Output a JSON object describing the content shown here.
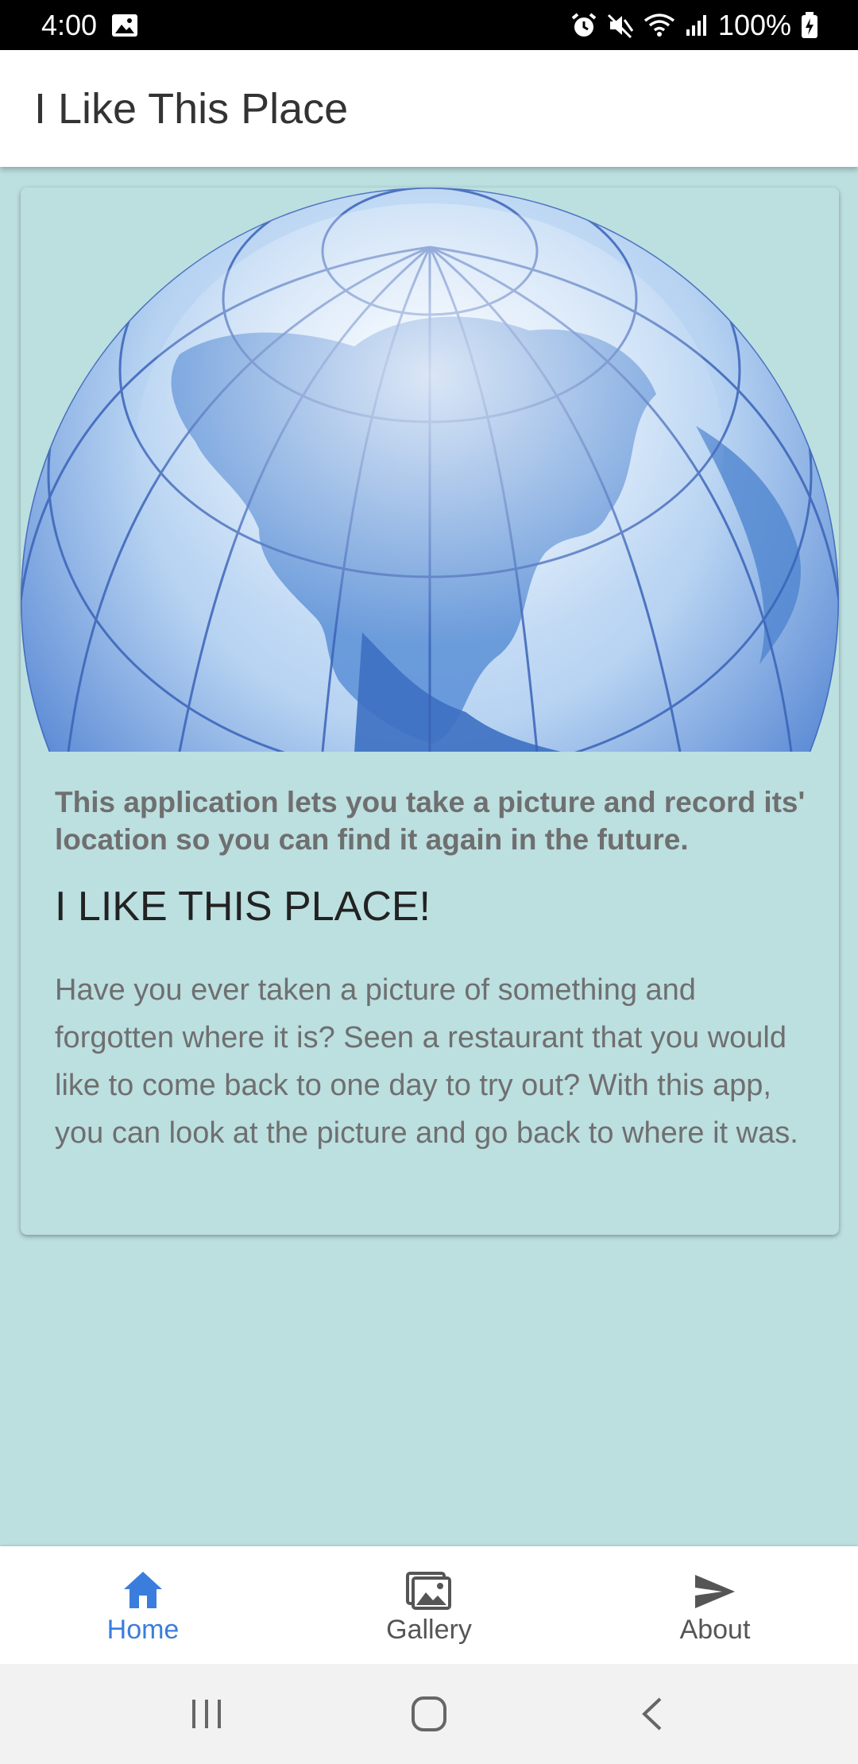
{
  "status_bar": {
    "time": "4:00",
    "battery": "100%"
  },
  "app_bar": {
    "title": "I Like This Place"
  },
  "card": {
    "subtitle": "This application lets you take a picture and record its' location so you can find it again in the future.",
    "heading": "I LIKE THIS PLACE!",
    "body": "Have you ever taken a picture of something and forgotten where it is? Seen a restaurant that you would like to come back to one day to try out? With this app, you can look at the picture and go back to where it was."
  },
  "bottom_nav": {
    "items": [
      {
        "label": "Home",
        "icon": "home-icon",
        "active": true
      },
      {
        "label": "Gallery",
        "icon": "gallery-icon",
        "active": false
      },
      {
        "label": "About",
        "icon": "send-icon",
        "active": false
      }
    ]
  },
  "colors": {
    "background": "#bcdfe0",
    "accent": "#3b7ddd",
    "globe": "#4a7fcf"
  }
}
